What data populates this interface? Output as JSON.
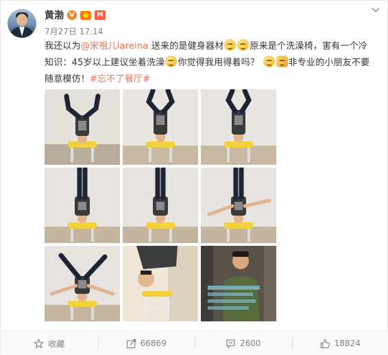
{
  "post": {
    "author": "黄渤",
    "mbadge": "M",
    "timestamp": "7月27日 17:14",
    "text": {
      "l1_a": "我还以为",
      "mention": "@宋祖儿lareina",
      "l1_b": " 送来的是健身器材",
      "l1_c": "原来是个洗澡椅，害有一个冷",
      "l2_a": "知识：45岁以上建议坐着洗澡",
      "l2_b": "你觉得我用得着吗？",
      "l2_c": "非专业的小朋友不要",
      "l3_a": "随意模仿！",
      "hashtag": "#忘不了餐厅#"
    },
    "images": [
      {
        "kind": "headstand",
        "pose": "legs-split"
      },
      {
        "kind": "headstand",
        "pose": "legs-bent"
      },
      {
        "kind": "headstand",
        "pose": "legs-bent"
      },
      {
        "kind": "headstand",
        "pose": "legs-straight"
      },
      {
        "kind": "headstand",
        "pose": "legs-straight"
      },
      {
        "kind": "headstand",
        "pose": "arms-out"
      },
      {
        "kind": "headstand",
        "pose": "legs-wide"
      },
      {
        "kind": "closeup-chair"
      },
      {
        "kind": "tv-still"
      }
    ]
  },
  "actions": {
    "favorite": "收藏",
    "forward": "66869",
    "comment": "2600",
    "like": "18824"
  },
  "colors": {
    "link": "#eb7350",
    "muted": "#808080",
    "vip_orange": "#f58220"
  }
}
